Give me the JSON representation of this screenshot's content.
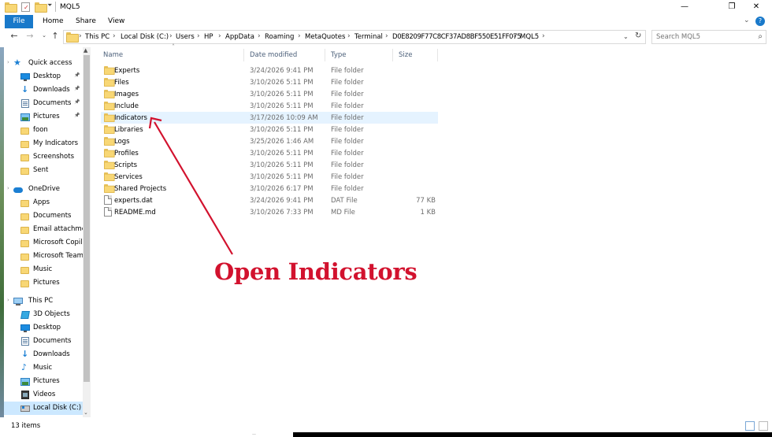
{
  "window": {
    "title": "MQL5",
    "controls": {
      "minimize": "—",
      "maximize": "❐",
      "close": "✕"
    }
  },
  "ribbon": {
    "tabs": [
      "File",
      "Home",
      "Share",
      "View"
    ],
    "expand_icon": "chevron-down-icon",
    "help_icon": "help-icon"
  },
  "address": {
    "crumbs": [
      "This PC",
      "Local Disk (C:)",
      "Users",
      "HP",
      "AppData",
      "Roaming",
      "MetaQuotes",
      "Terminal",
      "D0E8209F77C8CF37AD8BF550E51FF075",
      "MQL5"
    ],
    "search_placeholder": "Search MQL5"
  },
  "navpane": {
    "quick_access": {
      "label": "Quick access"
    },
    "quick_items": [
      {
        "label": "Desktop",
        "icon": "desktop-icon",
        "pinned": true
      },
      {
        "label": "Downloads",
        "icon": "download-icon",
        "pinned": true
      },
      {
        "label": "Documents",
        "icon": "documents-icon",
        "pinned": true
      },
      {
        "label": "Pictures",
        "icon": "pictures-icon",
        "pinned": true
      },
      {
        "label": "foon",
        "icon": "folder-icon",
        "pinned": false
      },
      {
        "label": "My Indicators",
        "icon": "folder-icon",
        "pinned": false
      },
      {
        "label": "Screenshots",
        "icon": "folder-icon",
        "pinned": false
      },
      {
        "label": "Sent",
        "icon": "folder-icon",
        "pinned": false
      }
    ],
    "onedrive": {
      "label": "OneDrive"
    },
    "onedrive_items": [
      {
        "label": "Apps"
      },
      {
        "label": "Documents"
      },
      {
        "label": "Email attachmen"
      },
      {
        "label": "Microsoft Copilo"
      },
      {
        "label": "Microsoft Teams"
      },
      {
        "label": "Music"
      },
      {
        "label": "Pictures"
      }
    ],
    "thispc": {
      "label": "This PC"
    },
    "thispc_items": [
      {
        "label": "3D Objects",
        "icon": "3d-objects-icon"
      },
      {
        "label": "Desktop",
        "icon": "desktop-icon"
      },
      {
        "label": "Documents",
        "icon": "documents-icon"
      },
      {
        "label": "Downloads",
        "icon": "download-icon"
      },
      {
        "label": "Music",
        "icon": "music-icon"
      },
      {
        "label": "Pictures",
        "icon": "pictures-icon"
      },
      {
        "label": "Videos",
        "icon": "videos-icon"
      },
      {
        "label": "Local Disk (C:)",
        "icon": "drive-icon",
        "selected": true
      }
    ]
  },
  "columns": {
    "name": "Name",
    "date": "Date modified",
    "type": "Type",
    "size": "Size"
  },
  "files": [
    {
      "name": "Experts",
      "date": "3/24/2026 9:41 PM",
      "type": "File folder",
      "size": "",
      "kind": "folder"
    },
    {
      "name": "Files",
      "date": "3/10/2026 5:11 PM",
      "type": "File folder",
      "size": "",
      "kind": "folder"
    },
    {
      "name": "Images",
      "date": "3/10/2026 5:11 PM",
      "type": "File folder",
      "size": "",
      "kind": "folder"
    },
    {
      "name": "Include",
      "date": "3/10/2026 5:11 PM",
      "type": "File folder",
      "size": "",
      "kind": "folder"
    },
    {
      "name": "Indicators",
      "date": "3/17/2026 10:09 AM",
      "type": "File folder",
      "size": "",
      "kind": "folder",
      "highlighted": true
    },
    {
      "name": "Libraries",
      "date": "3/10/2026 5:11 PM",
      "type": "File folder",
      "size": "",
      "kind": "folder"
    },
    {
      "name": "Logs",
      "date": "3/25/2026 1:46 AM",
      "type": "File folder",
      "size": "",
      "kind": "folder"
    },
    {
      "name": "Profiles",
      "date": "3/10/2026 5:11 PM",
      "type": "File folder",
      "size": "",
      "kind": "folder"
    },
    {
      "name": "Scripts",
      "date": "3/10/2026 5:11 PM",
      "type": "File folder",
      "size": "",
      "kind": "folder"
    },
    {
      "name": "Services",
      "date": "3/10/2026 5:11 PM",
      "type": "File folder",
      "size": "",
      "kind": "folder"
    },
    {
      "name": "Shared Projects",
      "date": "3/10/2026 6:17 PM",
      "type": "File folder",
      "size": "",
      "kind": "folder"
    },
    {
      "name": "experts.dat",
      "date": "3/24/2026 9:41 PM",
      "type": "DAT File",
      "size": "77 KB",
      "kind": "file"
    },
    {
      "name": "README.md",
      "date": "3/10/2026 7:33 PM",
      "type": "MD File",
      "size": "1 KB",
      "kind": "file"
    }
  ],
  "status": {
    "count": "13 items"
  },
  "annotation": {
    "text": "Open Indicators",
    "color": "#d2122e"
  },
  "colors": {
    "accent": "#1979ca",
    "selection": "#cce8ff",
    "hover": "#e5f3ff",
    "folder": "#f8d775"
  }
}
